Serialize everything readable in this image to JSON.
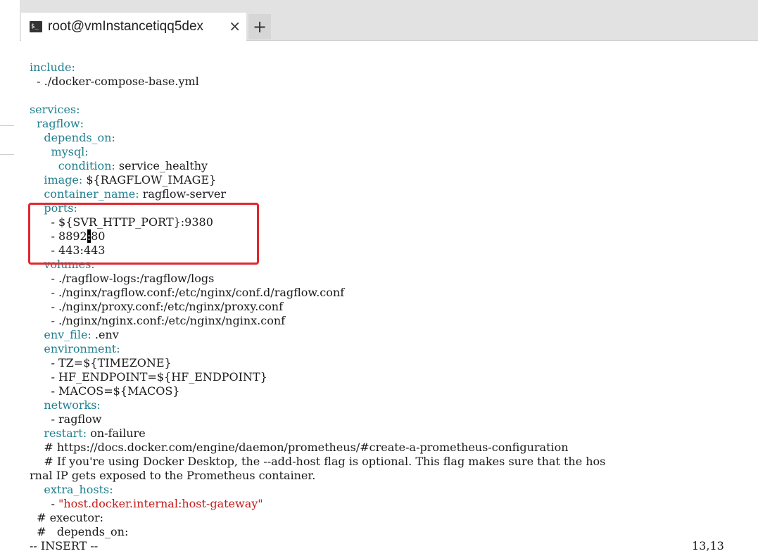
{
  "tab": {
    "title": "root@vmInstancetiqq5dex",
    "icon": "terminal-icon",
    "icon_text": "$_",
    "close_label": "×",
    "new_tab_label": "+"
  },
  "colors": {
    "key": "#1f7f8f",
    "string": "#c41a1a",
    "annotation_box": "#e0282e"
  },
  "lines": [
    [
      {
        "t": "include:",
        "c": "k"
      }
    ],
    [
      {
        "t": "  - ./docker-compose-base.yml"
      }
    ],
    [
      {
        "t": ""
      }
    ],
    [
      {
        "t": "services:",
        "c": "k"
      }
    ],
    [
      {
        "t": "  "
      },
      {
        "t": "ragflow:",
        "c": "k"
      }
    ],
    [
      {
        "t": "    "
      },
      {
        "t": "depends_on:",
        "c": "k"
      }
    ],
    [
      {
        "t": "      "
      },
      {
        "t": "mysql:",
        "c": "k"
      }
    ],
    [
      {
        "t": "        "
      },
      {
        "t": "condition:",
        "c": "k"
      },
      {
        "t": " service_healthy"
      }
    ],
    [
      {
        "t": "    "
      },
      {
        "t": "image:",
        "c": "k"
      },
      {
        "t": " ${RAGFLOW_IMAGE}"
      }
    ],
    [
      {
        "t": "    "
      },
      {
        "t": "container_name:",
        "c": "k"
      },
      {
        "t": " ragflow-server"
      }
    ],
    [
      {
        "t": "    "
      },
      {
        "t": "ports:",
        "c": "k"
      }
    ],
    [
      {
        "t": "      - ${SVR_HTTP_PORT}:9380"
      }
    ],
    [
      {
        "t": "      - 8892"
      },
      {
        "t": ":",
        "c": "cursor"
      },
      {
        "t": "80"
      }
    ],
    [
      {
        "t": "      - 443:443"
      }
    ],
    [
      {
        "t": "    "
      },
      {
        "t": "volumes:",
        "c": "k"
      }
    ],
    [
      {
        "t": "      - ./ragflow-logs:/ragflow/logs"
      }
    ],
    [
      {
        "t": "      - ./nginx/ragflow.conf:/etc/nginx/conf.d/ragflow.conf"
      }
    ],
    [
      {
        "t": "      - ./nginx/proxy.conf:/etc/nginx/proxy.conf"
      }
    ],
    [
      {
        "t": "      - ./nginx/nginx.conf:/etc/nginx/nginx.conf"
      }
    ],
    [
      {
        "t": "    "
      },
      {
        "t": "env_file:",
        "c": "k"
      },
      {
        "t": " .env"
      }
    ],
    [
      {
        "t": "    "
      },
      {
        "t": "environment:",
        "c": "k"
      }
    ],
    [
      {
        "t": "      - TZ=${TIMEZONE}"
      }
    ],
    [
      {
        "t": "      - HF_ENDPOINT=${HF_ENDPOINT}"
      }
    ],
    [
      {
        "t": "      - MACOS=${MACOS}"
      }
    ],
    [
      {
        "t": "    "
      },
      {
        "t": "networks:",
        "c": "k"
      }
    ],
    [
      {
        "t": "      - ragflow"
      }
    ],
    [
      {
        "t": "    "
      },
      {
        "t": "restart:",
        "c": "k"
      },
      {
        "t": " on-failure"
      }
    ],
    [
      {
        "t": "    # https://docs.docker.com/engine/daemon/prometheus/#create-a-prometheus-configuration"
      }
    ],
    [
      {
        "t": "    # If you're using Docker Desktop, the --add-host flag is optional. This flag makes sure that the hos"
      }
    ],
    [
      {
        "t": "rnal IP gets exposed to the Prometheus container."
      }
    ],
    [
      {
        "t": "    "
      },
      {
        "t": "extra_hosts:",
        "c": "k"
      }
    ],
    [
      {
        "t": "      - "
      },
      {
        "t": "\"host.docker.internal:host-gateway\"",
        "c": "s"
      }
    ],
    [
      {
        "t": "  # executor:"
      }
    ],
    [
      {
        "t": "  #   depends_on:"
      }
    ]
  ],
  "status": {
    "mode": "-- INSERT --",
    "position": "13,13"
  }
}
